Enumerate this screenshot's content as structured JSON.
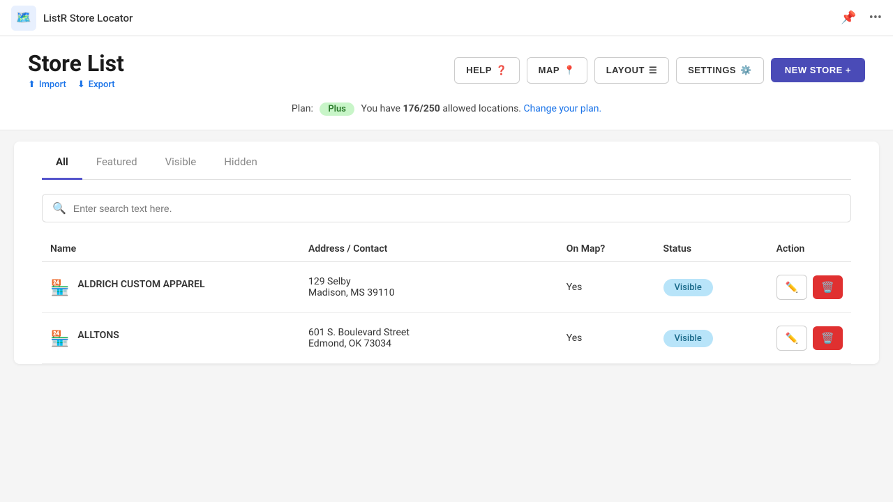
{
  "topbar": {
    "app_logo": "🗺️",
    "app_title": "ListR Store Locator",
    "pin_icon": "📌",
    "more_icon": "•••"
  },
  "header": {
    "page_title": "Store List",
    "import_label": "Import",
    "export_label": "Export",
    "buttons": [
      {
        "id": "help",
        "label": "HELP",
        "icon": "❓"
      },
      {
        "id": "map",
        "label": "MAP",
        "icon": "📍"
      },
      {
        "id": "layout",
        "label": "LAYOUT",
        "icon": "☰"
      },
      {
        "id": "settings",
        "label": "SETTINGS",
        "icon": "⚙️"
      }
    ],
    "new_store_label": "NEW STORE +"
  },
  "plan_bar": {
    "label": "Plan:",
    "plan_badge": "Plus",
    "message_prefix": "You have ",
    "current": "176/250",
    "message_suffix": " allowed locations.",
    "change_plan_text": "Change your plan."
  },
  "tabs": [
    {
      "id": "all",
      "label": "All",
      "active": true
    },
    {
      "id": "featured",
      "label": "Featured",
      "active": false
    },
    {
      "id": "visible",
      "label": "Visible",
      "active": false
    },
    {
      "id": "hidden",
      "label": "Hidden",
      "active": false
    }
  ],
  "search": {
    "placeholder": "Enter search text here."
  },
  "table": {
    "columns": [
      {
        "id": "name",
        "label": "Name"
      },
      {
        "id": "address",
        "label": "Address / Contact"
      },
      {
        "id": "on_map",
        "label": "On Map?"
      },
      {
        "id": "status",
        "label": "Status"
      },
      {
        "id": "action",
        "label": "Action"
      }
    ],
    "rows": [
      {
        "id": 1,
        "name": "ALDRICH CUSTOM APPAREL",
        "address_line1": "129 Selby",
        "address_line2": "Madison, MS 39110",
        "on_map": "Yes",
        "status": "Visible"
      },
      {
        "id": 2,
        "name": "ALLTONS",
        "address_line1": "601 S. Boulevard Street",
        "address_line2": "Edmond, OK 73034",
        "on_map": "Yes",
        "status": "Visible"
      }
    ]
  },
  "icons": {
    "store_icon": "🏪",
    "edit_icon": "✏️",
    "delete_icon": "🗑️",
    "search_icon": "🔍",
    "upload_icon": "⬆",
    "download_icon": "⬇"
  }
}
